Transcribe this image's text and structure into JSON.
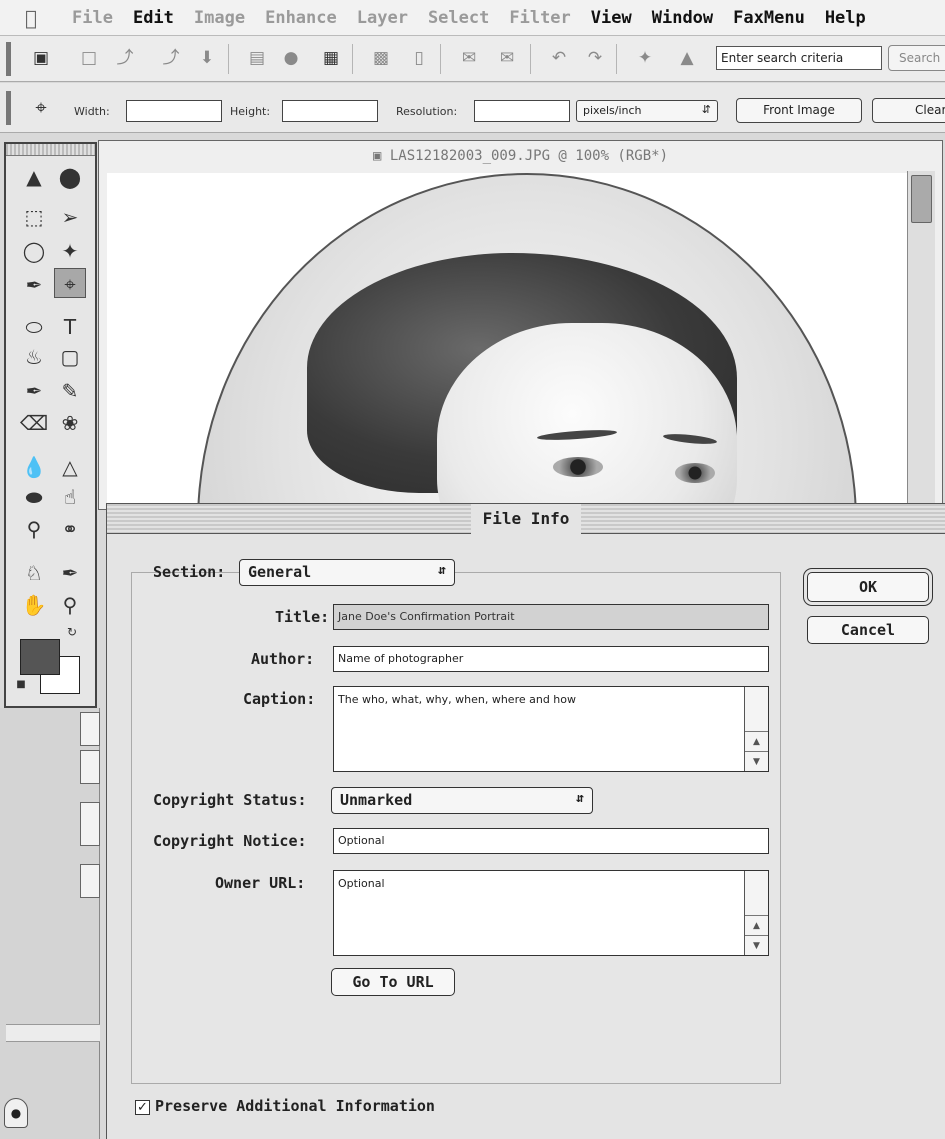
{
  "menubar": {
    "apple_icon": "apple-icon",
    "items": [
      {
        "label": "File",
        "enabled": false
      },
      {
        "label": "Edit",
        "enabled": true
      },
      {
        "label": "Image",
        "enabled": false
      },
      {
        "label": "Enhance",
        "enabled": false
      },
      {
        "label": "Layer",
        "enabled": false
      },
      {
        "label": "Select",
        "enabled": false
      },
      {
        "label": "Filter",
        "enabled": false
      },
      {
        "label": "View",
        "enabled": true
      },
      {
        "label": "Window",
        "enabled": true
      },
      {
        "label": "FaxMenu",
        "enabled": true
      },
      {
        "label": "Help",
        "enabled": true
      }
    ]
  },
  "shortcuts": {
    "search_placeholder": "Enter search criteria",
    "search_button": "Search"
  },
  "options": {
    "width_label": "Width:",
    "height_label": "Height:",
    "resolution_label": "Resolution:",
    "units_value": "pixels/inch",
    "front_image_button": "Front Image",
    "clear_button": "Clear"
  },
  "document": {
    "title": "LAS12182003_009.JPG @ 100% (RGB*)"
  },
  "dialog": {
    "title": "File Info",
    "section_label": "Section:",
    "section_value": "General",
    "title_label": "Title:",
    "title_value": "Jane Doe's Confirmation Portrait",
    "author_label": "Author:",
    "author_value": "Name of photographer",
    "caption_label": "Caption:",
    "caption_value": "The who, what, why, when, where and how",
    "copyright_status_label": "Copyright Status:",
    "copyright_status_value": "Unmarked",
    "copyright_notice_label": "Copyright Notice:",
    "copyright_notice_value": "Optional",
    "owner_url_label": "Owner URL:",
    "owner_url_value": "Optional",
    "go_to_url_button": "Go To URL",
    "ok_button": "OK",
    "cancel_button": "Cancel",
    "preserve_label": "Preserve Additional Information",
    "preserve_checked": true
  }
}
